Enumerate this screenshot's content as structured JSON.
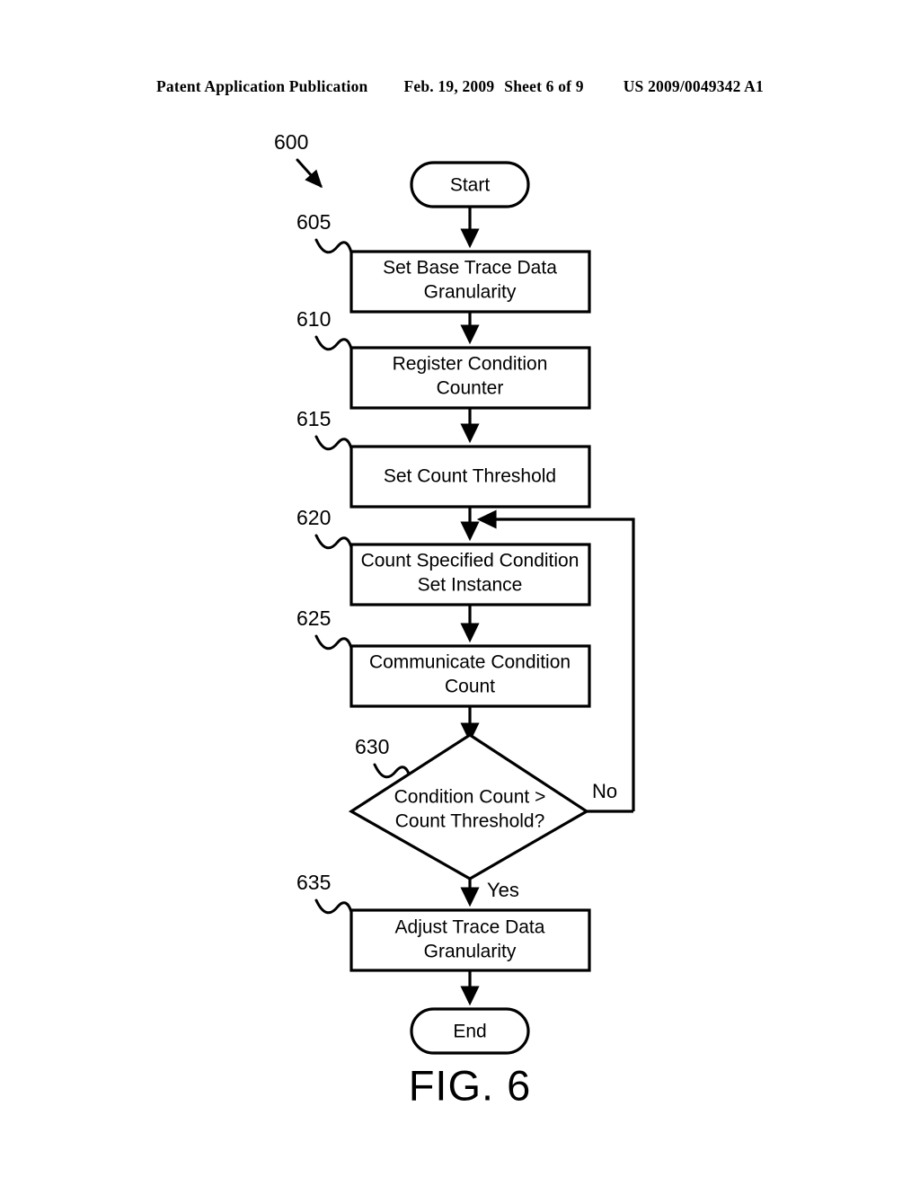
{
  "header": {
    "publication": "Patent Application Publication",
    "date": "Feb. 19, 2009",
    "sheet": "Sheet 6 of 9",
    "patent_number": "US 2009/0049342 A1"
  },
  "figure": {
    "caption": "FIG. 6",
    "diagram_ref": "600",
    "type": "flowchart",
    "nodes": [
      {
        "ref": "",
        "id": "start",
        "shape": "terminator",
        "label": "Start"
      },
      {
        "ref": "605",
        "id": "set-base",
        "shape": "process",
        "label": "Set Base Trace Data Granularity",
        "line1": "Set Base Trace Data",
        "line2": "Granularity"
      },
      {
        "ref": "610",
        "id": "register",
        "shape": "process",
        "label": "Register Condition Counter",
        "line1": "Register Condition",
        "line2": "Counter"
      },
      {
        "ref": "615",
        "id": "threshold",
        "shape": "process",
        "label": "Set Count Threshold",
        "line1": "Set Count Threshold",
        "line2": ""
      },
      {
        "ref": "620",
        "id": "count",
        "shape": "process",
        "label": "Count Specified Condition Set Instance",
        "line1": "Count Specified Condition",
        "line2": "Set Instance"
      },
      {
        "ref": "625",
        "id": "communicate",
        "shape": "process",
        "label": "Communicate Condition Count",
        "line1": "Communicate Condition",
        "line2": "Count"
      },
      {
        "ref": "630",
        "id": "decision",
        "shape": "decision",
        "label": "Condition Count > Count Threshold?",
        "line1": "Condition Count >",
        "line2": "Count Threshold?"
      },
      {
        "ref": "635",
        "id": "adjust",
        "shape": "process",
        "label": "Adjust Trace Data Granularity",
        "line1": "Adjust Trace Data",
        "line2": "Granularity"
      },
      {
        "ref": "",
        "id": "end",
        "shape": "terminator",
        "label": "End"
      }
    ],
    "branch_labels": {
      "no": "No",
      "yes": "Yes"
    },
    "colors": {
      "stroke": "#000000",
      "fill": "#ffffff",
      "text": "#000000"
    }
  }
}
